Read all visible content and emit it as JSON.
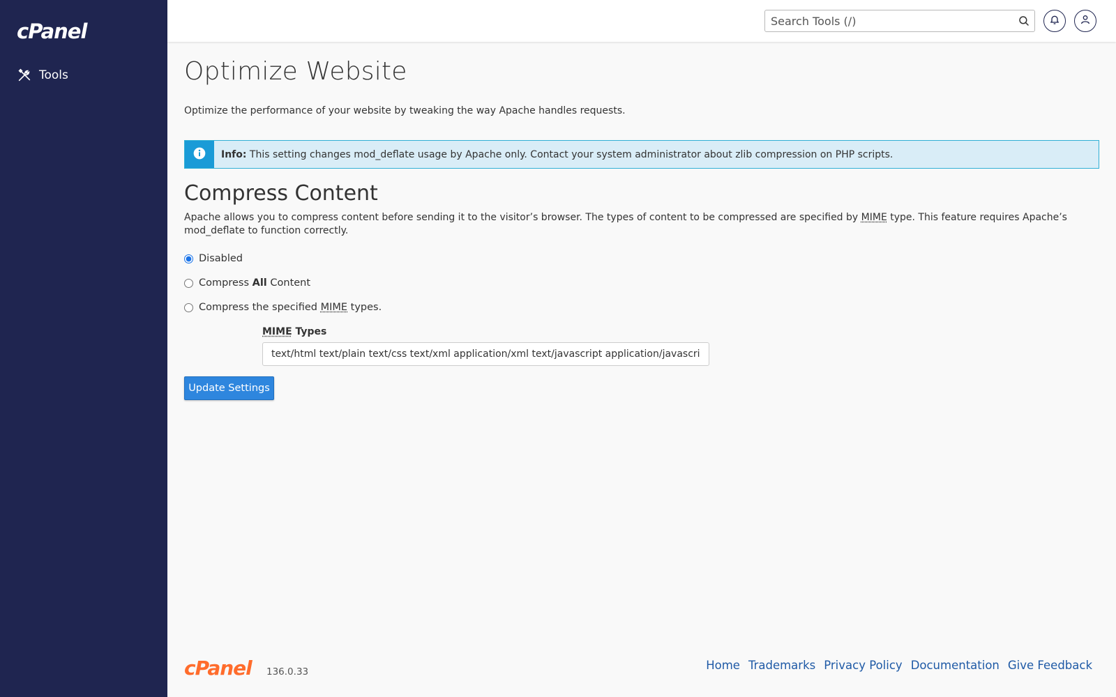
{
  "sidebar": {
    "logo": "cPanel",
    "items": [
      {
        "label": "Tools",
        "icon": "tools-icon"
      }
    ],
    "bg_color": "#1f2550"
  },
  "header": {
    "search": {
      "placeholder": "Search Tools (/)",
      "value": ""
    },
    "bell_icon": "bell-icon",
    "user_icon": "user-icon"
  },
  "main": {
    "title": "Optimize Website",
    "description": "Optimize the performance of your website by tweaking the way Apache handles requests.",
    "info": {
      "label": "Info:",
      "text": " This setting changes mod_deflate usage by Apache only. Contact your system administrator about zlib compression on PHP scripts."
    },
    "section": {
      "title": "Compress Content",
      "desc_part1": "Apache allows you to compress content before sending it to the visitor’s browser. The types of content to be compressed are specified by ",
      "desc_abbr": "MIME",
      "desc_part2": " type. This feature requires Apache’s mod_deflate to function correctly."
    },
    "options": {
      "disabled": "Disabled",
      "all_prefix": "Compress ",
      "all_bold": "All",
      "all_suffix": " Content",
      "specified_prefix": "Compress the specified ",
      "specified_abbr": "MIME",
      "specified_suffix": " types.",
      "selected": "disabled"
    },
    "mime": {
      "label_abbr": "MIME",
      "label_suffix": " Types",
      "value": "text/html text/plain text/css text/xml application/xml text/javascript application/javascript"
    },
    "update_button": "Update Settings"
  },
  "footer": {
    "logo": "cPanel",
    "version": "136.0.33",
    "links": [
      "Home",
      "Trademarks",
      "Privacy Policy",
      "Documentation",
      "Give Feedback"
    ]
  },
  "colors": {
    "accent": "#2e86de",
    "info_bg": "#d9edf7",
    "info_icon_bg": "#1a9bd7",
    "footer_logo": "#ff6c2c",
    "link": "#1f5aa6"
  }
}
